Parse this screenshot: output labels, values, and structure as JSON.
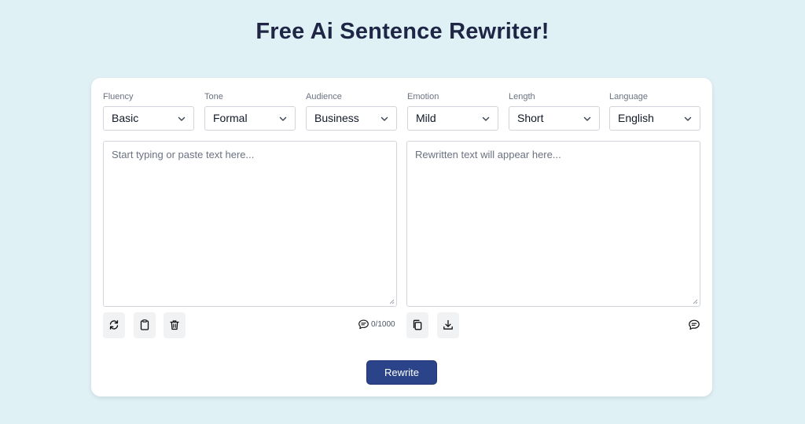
{
  "header": {
    "title": "Free Ai Sentence Rewriter!"
  },
  "options": [
    {
      "label": "Fluency",
      "value": "Basic"
    },
    {
      "label": "Tone",
      "value": "Formal"
    },
    {
      "label": "Audience",
      "value": "Business"
    },
    {
      "label": "Emotion",
      "value": "Mild"
    },
    {
      "label": "Length",
      "value": "Short"
    },
    {
      "label": "Language",
      "value": "English"
    }
  ],
  "input": {
    "placeholder": "Start typing or paste text here...",
    "counter": "0/1000",
    "tools": [
      "refresh-icon",
      "clipboard-icon",
      "trash-icon"
    ]
  },
  "output": {
    "placeholder": "Rewritten text will appear here...",
    "tools": [
      "copy-icon",
      "download-icon",
      "comment-icon"
    ]
  },
  "action": {
    "rewrite_label": "Rewrite"
  },
  "colors": {
    "background": "#e0f1f6",
    "title": "#1e2545",
    "button": "#2b4489"
  }
}
